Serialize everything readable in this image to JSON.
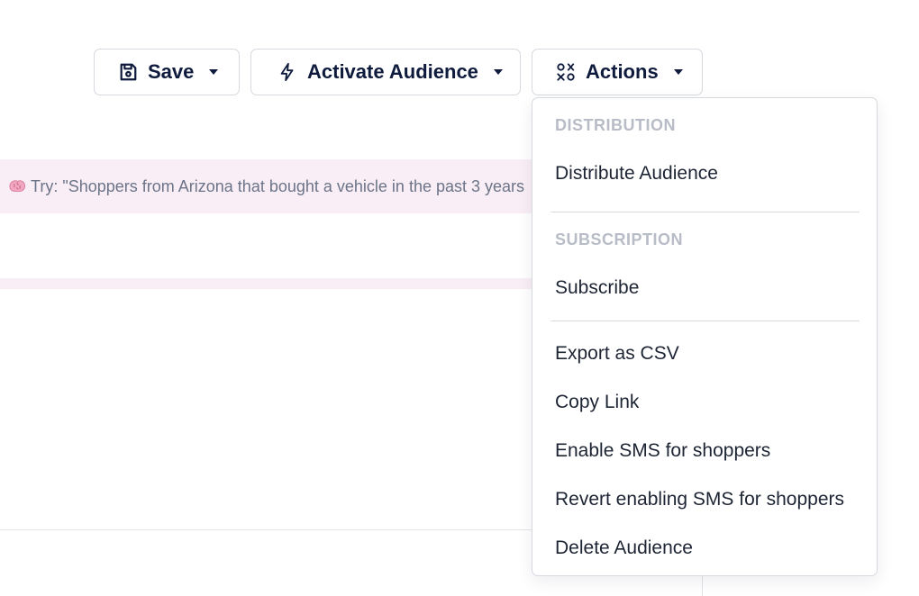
{
  "toolbar": {
    "save_label": "Save",
    "activate_label": "Activate Audience",
    "actions_label": "Actions"
  },
  "prompt": {
    "hint": "Try: \"Shoppers from Arizona that bought a vehicle in the past 3 years"
  },
  "actions_menu": {
    "distribution_header": "DISTRIBUTION",
    "distribute": "Distribute Audience",
    "subscription_header": "SUBSCRIPTION",
    "subscribe": "Subscribe",
    "export_csv": "Export as CSV",
    "copy_link": "Copy Link",
    "enable_sms": "Enable SMS for shoppers",
    "revert_sms": "Revert enabling SMS for shoppers",
    "delete": "Delete Audience"
  },
  "icons": {
    "save": "floppy-disk-icon",
    "activate": "lightning-bolt-icon",
    "actions": "shapes-icon",
    "caret": "caret-down-icon",
    "hint": "brain-icon"
  },
  "colors": {
    "button_text": "#0f1b3d",
    "banner_bg": "#f9eef5",
    "section_header": "#b8bcc6",
    "border": "#d6d9de"
  }
}
